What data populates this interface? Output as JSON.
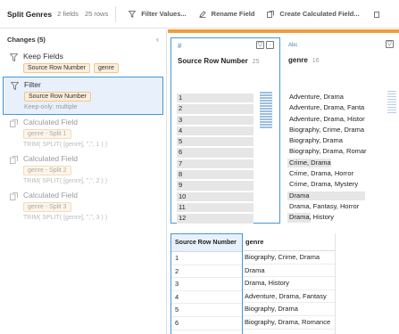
{
  "toolbar": {
    "title": "Split Genres",
    "fields": "2 fields",
    "rows": "25 rows",
    "buttons": [
      {
        "label": "Filter Values...",
        "icon": "filter-icon"
      },
      {
        "label": "Rename Field",
        "icon": "rename-icon"
      },
      {
        "label": "Create Calculated Field...",
        "icon": "calculated-field-icon"
      }
    ]
  },
  "changes": {
    "header": "Changes (5)",
    "items": [
      {
        "title": "Keep Fields",
        "chips": [
          "Source Row Number",
          "genre"
        ],
        "sub": ""
      },
      {
        "title": "Filter",
        "chips": [
          "Source Row Number"
        ],
        "sub": "Keep-only: multiple"
      },
      {
        "title": "Calculated Field",
        "chips": [
          "genre - Split 1"
        ],
        "sub": "TRIM( SPLIT( [genre], \",\", 1 ) )"
      },
      {
        "title": "Calculated Field",
        "chips": [
          "genre - Split 2"
        ],
        "sub": "TRIM( SPLIT( [genre], \",\", 2 ) )"
      },
      {
        "title": "Calculated Field",
        "chips": [
          "genre - Split 3"
        ],
        "sub": "TRIM( SPLIT( [genre], \",\", 3 ) )"
      }
    ]
  },
  "profile": {
    "accent": "#f39b3b",
    "selection": "#4996d4",
    "cards": [
      {
        "type": "#",
        "name": "Source Row Number",
        "count": "25",
        "values": [
          "1",
          "2",
          "3",
          "4",
          "5",
          "6",
          "7",
          "8",
          "9",
          "10",
          "11",
          "12"
        ]
      },
      {
        "type": "Abc",
        "name": "genre",
        "count": "16",
        "values": [
          "Adventure, Drama",
          "Adventure, Drama, Fanta",
          "Adventure, Drama, Histor",
          "Biography, Crime, Drama",
          "Biography, Drama",
          "Biography, Drama, Romar",
          "Crime, Drama",
          "Crime, Drama, Horror",
          "Crime, Drama, Mystery",
          "Drama",
          "Drama, Fantasy, Horror",
          "Drama, History"
        ],
        "bars": [
          0,
          0,
          0,
          0,
          0,
          0,
          0.42,
          0,
          0,
          0.75,
          0,
          0.22
        ]
      }
    ]
  },
  "grid": {
    "headers": [
      "Source Row Number",
      "genre"
    ],
    "rows": [
      [
        "1",
        "Biography, Crime, Drama"
      ],
      [
        "2",
        "Drama"
      ],
      [
        "3",
        "Drama, History"
      ],
      [
        "4",
        "Adventure, Drama, Fantasy"
      ],
      [
        "5",
        "Biography, Drama"
      ],
      [
        "6",
        "Biography, Drama, Romance"
      ]
    ]
  }
}
